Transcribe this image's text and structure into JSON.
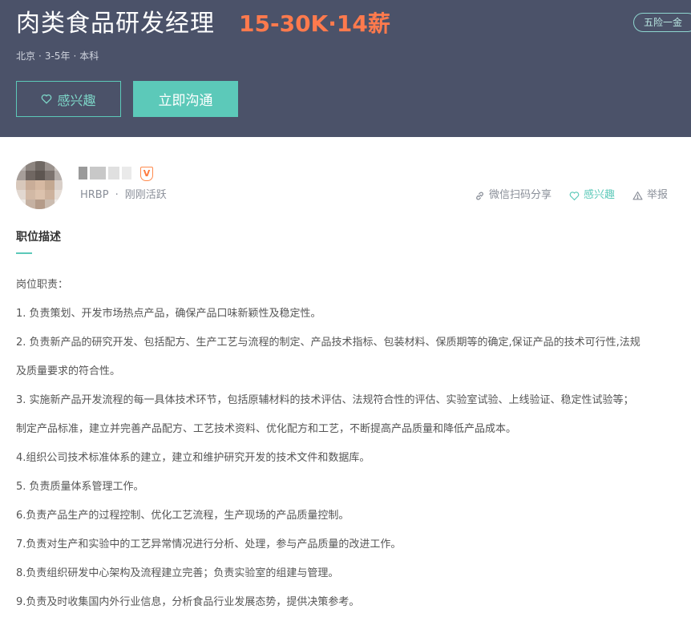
{
  "header": {
    "title": "肉类食品研发经理",
    "salary": "15-30K·14薪",
    "welfare_tag": "五险一金",
    "meta": {
      "city": "北京",
      "experience": "3-5年",
      "education": "本科"
    },
    "interest_button": "感兴趣",
    "chat_button": "立即沟通"
  },
  "recruiter": {
    "title": "HRBP",
    "status": "刚刚活跃",
    "badge": "V"
  },
  "actions": {
    "share": "微信扫码分享",
    "interest": "感兴趣",
    "report": "举报"
  },
  "description": {
    "section_title": "职位描述",
    "lines": [
      "岗位职责：",
      "1. 负责策划、开发市场热点产品，确保产品口味新颖性及稳定性。",
      "2. 负责新产品的研究开发、包括配方、生产工艺与流程的制定、产品技术指标、包装材料、保质期等的确定,保证产品的技术可行性,法规",
      "及质量要求的符合性。",
      "3. 实施新产品开发流程的每一具体技术环节，包括原辅材料的技术评估、法规符合性的评估、实验室试验、上线验证、稳定性试验等；",
      "制定产品标准，建立并完善产品配方、工艺技术资料、优化配方和工艺，不断提高产品质量和降低产品成本。",
      "4.组织公司技术标准体系的建立，建立和维护研究开发的技术文件和数据库。",
      "5. 负责质量体系管理工作。",
      "6.负责产品生产的过程控制、优化工艺流程，生产现场的产品质量控制。",
      "7.负责对生产和实验中的工艺异常情况进行分析、处理，参与产品质量的改进工作。",
      "8.负责组织研发中心架构及流程建立完善；负责实验室的组建与管理。",
      "9.负责及时收集国内外行业信息，分析食品行业发展态势，提供决策参考。"
    ]
  },
  "colors": {
    "banner": "#4b5269",
    "accent": "#5cc9b9",
    "salary": "#ff7a4d"
  },
  "icons": {
    "interest": "heart-icon",
    "share": "link-icon",
    "report": "warning-icon",
    "verified": "v-badge-icon"
  }
}
